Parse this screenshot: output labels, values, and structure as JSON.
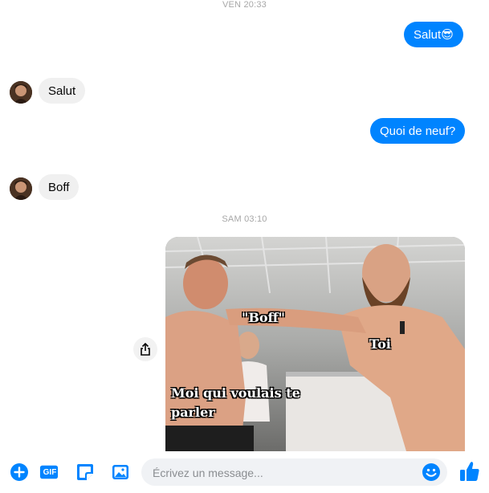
{
  "colors": {
    "accent": "#0084ff",
    "incoming_bubble": "#f0f0f0",
    "timestamp": "#a7a7a7"
  },
  "thread": {
    "timestamps": [
      "VEN 20:33",
      "SAM 03:10"
    ],
    "messages": [
      {
        "direction": "outgoing",
        "text": "Salut😎"
      },
      {
        "direction": "incoming",
        "text": "Salut"
      },
      {
        "direction": "outgoing",
        "text": "Quoi de neuf?"
      },
      {
        "direction": "incoming",
        "text": "Boff"
      }
    ],
    "meme": {
      "captions": [
        "\"Boff\"",
        "Toi",
        "Moi qui voulais te",
        "parler"
      ]
    },
    "share_icon": "share-icon"
  },
  "composer": {
    "placeholder": "Écrivez un message...",
    "value": "",
    "gif_label": "GIF",
    "icons": [
      "plus-icon",
      "gif-icon",
      "sticker-icon",
      "image-icon",
      "emoji-icon",
      "thumbs-up-icon"
    ]
  }
}
